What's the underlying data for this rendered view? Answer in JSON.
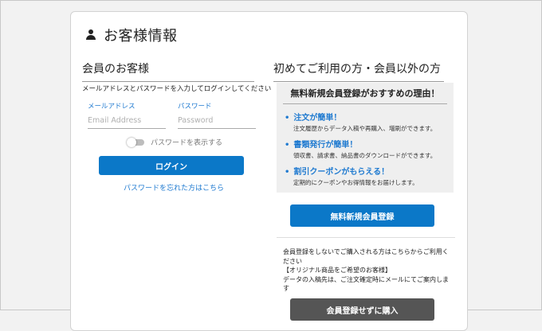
{
  "page": {
    "title": "お客様情報",
    "title_icon": "person-icon"
  },
  "member": {
    "heading": "会員のお客様",
    "instruction": "メールアドレスとパスワードを入力してログインしてください",
    "email_label": "メールアドレス",
    "email_placeholder": "Email Address",
    "email_value": "",
    "password_label": "パスワード",
    "password_placeholder": "Password",
    "password_value": "",
    "show_password_label": "パスワードを表示する",
    "show_password_on": false,
    "login_button": "ログイン",
    "forgot_link": "パスワードを忘れた方はこちら"
  },
  "new_user": {
    "heading": "初めてご利用の方・会員以外の方",
    "reasons_title": "無料新規会員登録がおすすめの理由！",
    "reasons": [
      {
        "bullet": "•",
        "title": "注文が簡単！",
        "desc": "注文履歴からデータ入稿や再購入、増刷ができます。"
      },
      {
        "bullet": "•",
        "title": "書類発行が簡単！",
        "desc": "領収書、請求書、納品書のダウンロードができます。"
      },
      {
        "bullet": "•",
        "title": "割引クーポンがもらえる！",
        "desc": "定期的にクーポンやお得情報をお届けします。"
      }
    ],
    "register_button": "無料新規会員登録",
    "guest_text_1": "会員登録をしないでご購入される方はこちらからご利用ください",
    "guest_text_2": "【オリジナル商品をご希望のお客様】",
    "guest_text_3": "データの入稿先は、ご注文確定時にメールにてご案内します",
    "guest_button": "会員登録せずに購入"
  },
  "colors": {
    "accent": "#0b78c8",
    "link": "#1f7ad0",
    "panel": "#efefef",
    "guest_button": "#555555"
  }
}
